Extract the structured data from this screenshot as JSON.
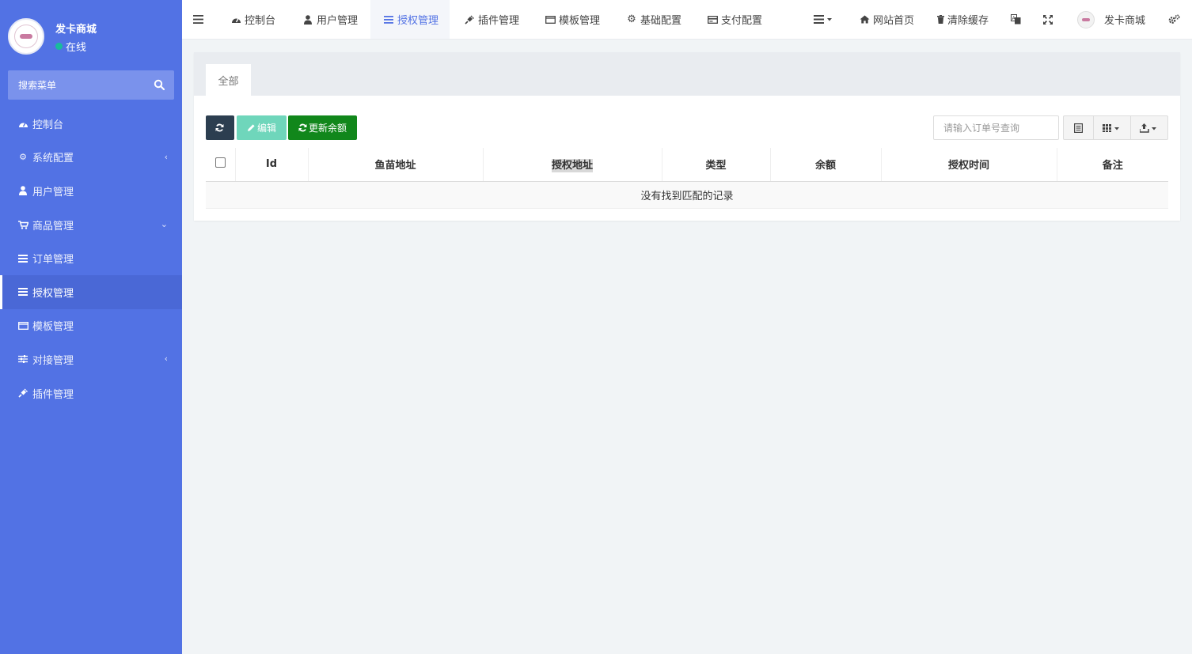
{
  "sidebar": {
    "user_name": "发卡商城",
    "status": "在线",
    "search_placeholder": "搜索菜单",
    "items": [
      {
        "label": "控制台",
        "icon": "dashboard-icon"
      },
      {
        "label": "系统配置",
        "icon": "gear-icon",
        "arrow": "‹"
      },
      {
        "label": "用户管理",
        "icon": "user-icon"
      },
      {
        "label": "商品管理",
        "icon": "cart-icon",
        "arrow": "⌄"
      },
      {
        "label": "订单管理",
        "icon": "list-icon"
      },
      {
        "label": "授权管理",
        "icon": "list-icon",
        "active": true
      },
      {
        "label": "模板管理",
        "icon": "template-icon"
      },
      {
        "label": "对接管理",
        "icon": "sliders-icon",
        "arrow": "‹"
      },
      {
        "label": "插件管理",
        "icon": "plug-icon"
      }
    ]
  },
  "topbar": {
    "nav": [
      {
        "label": "控制台"
      },
      {
        "label": "用户管理"
      },
      {
        "label": "授权管理",
        "active": true
      },
      {
        "label": "插件管理"
      },
      {
        "label": "模板管理"
      },
      {
        "label": "基础配置"
      },
      {
        "label": "支付配置"
      }
    ],
    "home_label": "网站首页",
    "clear_cache_label": "清除缓存",
    "user_name": "发卡商城"
  },
  "content": {
    "tab_label": "全部",
    "edit_label": "编辑",
    "update_balance_label": "更新余额",
    "search_placeholder": "请输入订单号查询",
    "columns": [
      "Id",
      "鱼苗地址",
      "授权地址",
      "类型",
      "余额",
      "授权时间",
      "备注"
    ],
    "empty_text": "没有找到匹配的记录"
  },
  "colors": {
    "sidebar": "#5272e4",
    "accent": "#5272e4",
    "success": "#11871b",
    "edit_disabled": "#6fd6bb",
    "dark": "#2c3e50"
  }
}
